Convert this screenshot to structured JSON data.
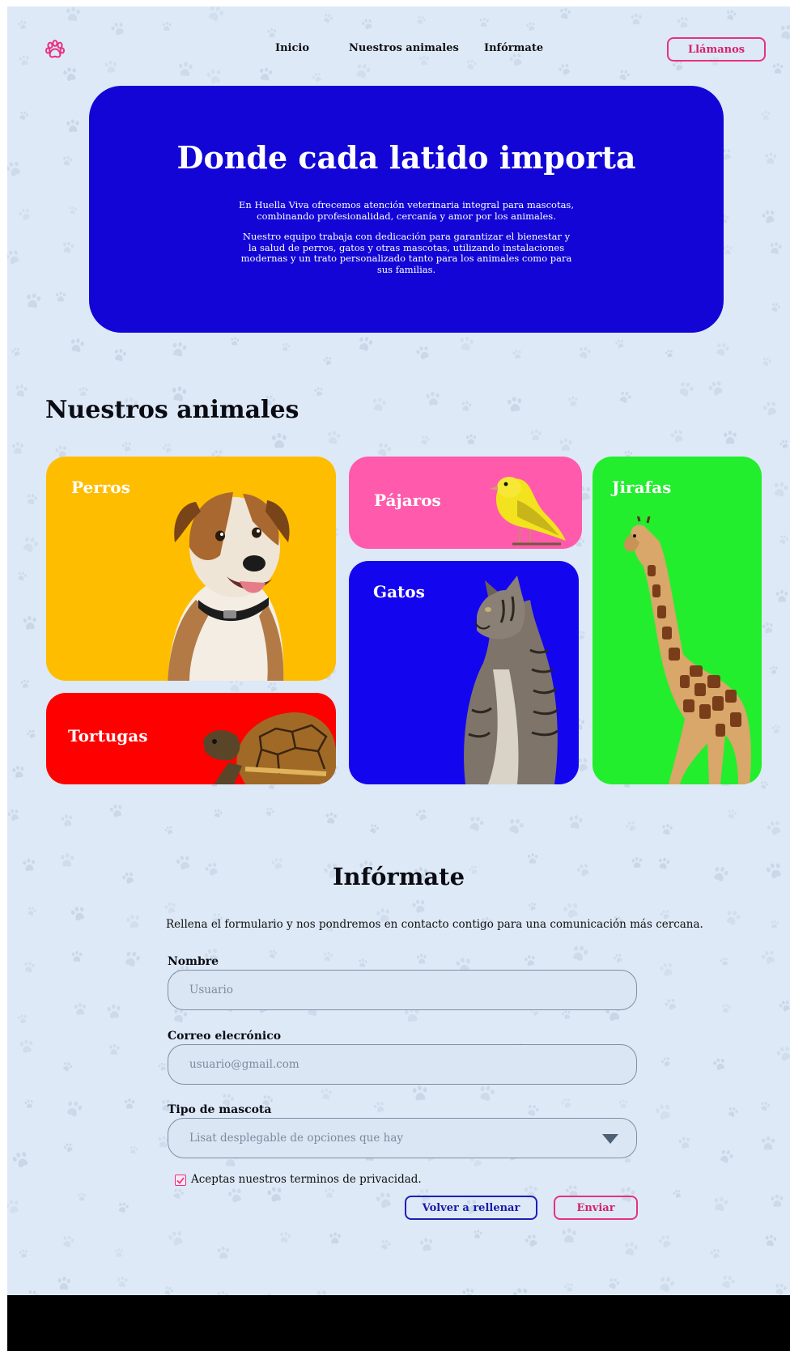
{
  "nav": {
    "logo_icon": "paw-icon",
    "links": [
      "Inicio",
      "Nuestros animales",
      "Infórmate"
    ],
    "call_button": "Llámanos"
  },
  "hero": {
    "title": "Donde cada latido importa",
    "paragraph1": "En Huella Viva ofrecemos atención veterinaria integral para mascotas, combinando profesionalidad, cercanía y amor por los animales.",
    "paragraph2": "Nuestro equipo trabaja con dedicación para garantizar el bienestar y la salud de perros, gatos y otras mascotas, utilizando instalaciones modernas y un trato personalizado tanto para los animales como para sus familias."
  },
  "animals": {
    "title": "Nuestros animales",
    "cards": [
      {
        "label": "Perros",
        "color": "#ffbd00",
        "image": "dog"
      },
      {
        "label": "Pájaros",
        "color": "#ff5aab",
        "image": "canary"
      },
      {
        "label": "Jirafas",
        "color": "#22ee2d",
        "image": "giraffe"
      },
      {
        "label": "Gatos",
        "color": "#1405ef",
        "image": "cat"
      },
      {
        "label": "Tortugas",
        "color": "#ff0000",
        "image": "turtle"
      }
    ]
  },
  "form": {
    "title": "Infórmate",
    "description": "Rellena el formulario y nos pondremos en contacto  contigo para una comunicación más cercana.",
    "name_label": "Nombre",
    "name_placeholder": "Usuario",
    "email_label": "Correo elecrónico",
    "email_placeholder": "usuario@gmail.com",
    "pet_label": "Tipo de mascota",
    "pet_select_text": "Lisat desplegable de opciones que hay",
    "privacy_label": "Aceptas nuestros terminos de privacidad.",
    "privacy_checked": true,
    "reset_button": "Volver a rellenar",
    "submit_button": "Enviar"
  },
  "colors": {
    "background": "#dde9f6",
    "hero": "#1205d6",
    "accent_pink": "#e9307f",
    "accent_blue": "#1f1fb5",
    "footer": "#000000"
  }
}
